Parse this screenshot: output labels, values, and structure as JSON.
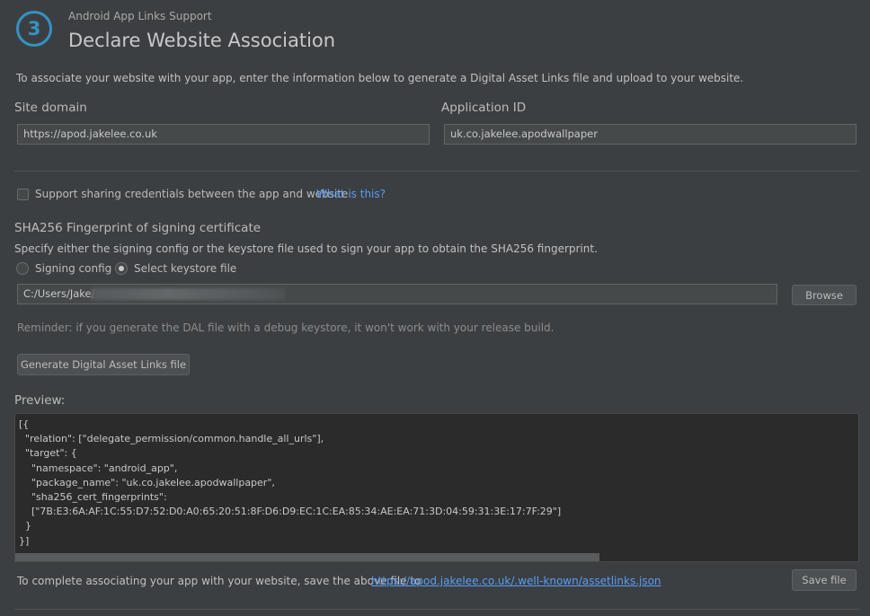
{
  "header": {
    "step_number": "3",
    "subtitle": "Android App Links Support",
    "title": "Declare Website Association"
  },
  "intro_text": "To associate your website with your app, enter the information below to generate a Digital Asset Links file and upload to your website.",
  "site_domain": {
    "label": "Site domain",
    "value": "https://apod.jakelee.co.uk"
  },
  "application_id": {
    "label": "Application ID",
    "value": "uk.co.jakelee.apodwallpaper"
  },
  "sharing": {
    "checkbox_label": "Support sharing credentials between the app and website",
    "checked": false,
    "help_link": "What is this?"
  },
  "fingerprint": {
    "heading": "SHA256 Fingerprint of signing certificate",
    "description": "Specify either the signing config or the keystore file used to sign your app to obtain the SHA256 fingerprint.",
    "options": [
      "Signing config",
      "Select keystore file"
    ],
    "selected": "Select keystore file",
    "keystore_path": "C:/Users/Jake/",
    "browse_label": "Browse"
  },
  "reminder": "Reminder: if you generate the DAL file with a debug keystore, it won't work with your release build.",
  "generate_button": "Generate Digital Asset Links file",
  "preview": {
    "label": "Preview:",
    "content": "[{\n  \"relation\": [\"delegate_permission/common.handle_all_urls\"],\n  \"target\": {\n    \"namespace\": \"android_app\",\n    \"package_name\": \"uk.co.jakelee.apodwallpaper\",\n    \"sha256_cert_fingerprints\":\n    [\"7B:E3:6A:AF:1C:55:D7:52:D0:A0:65:20:51:8F:D6:D9:EC:1C:EA:85:34:AE:EA:71:3D:04:59:31:3E:17:7F:29\"]\n  }\n}]"
  },
  "footer": {
    "text": "To complete associating your app with your website, save the above file to",
    "link": "https://apod.jakelee.co.uk/.well-known/assetlinks.json",
    "save_label": "Save file"
  },
  "colors": {
    "background": "#3c3f41",
    "accent": "#3592c4",
    "link": "#589df6",
    "code_background": "#2b2b2b"
  }
}
